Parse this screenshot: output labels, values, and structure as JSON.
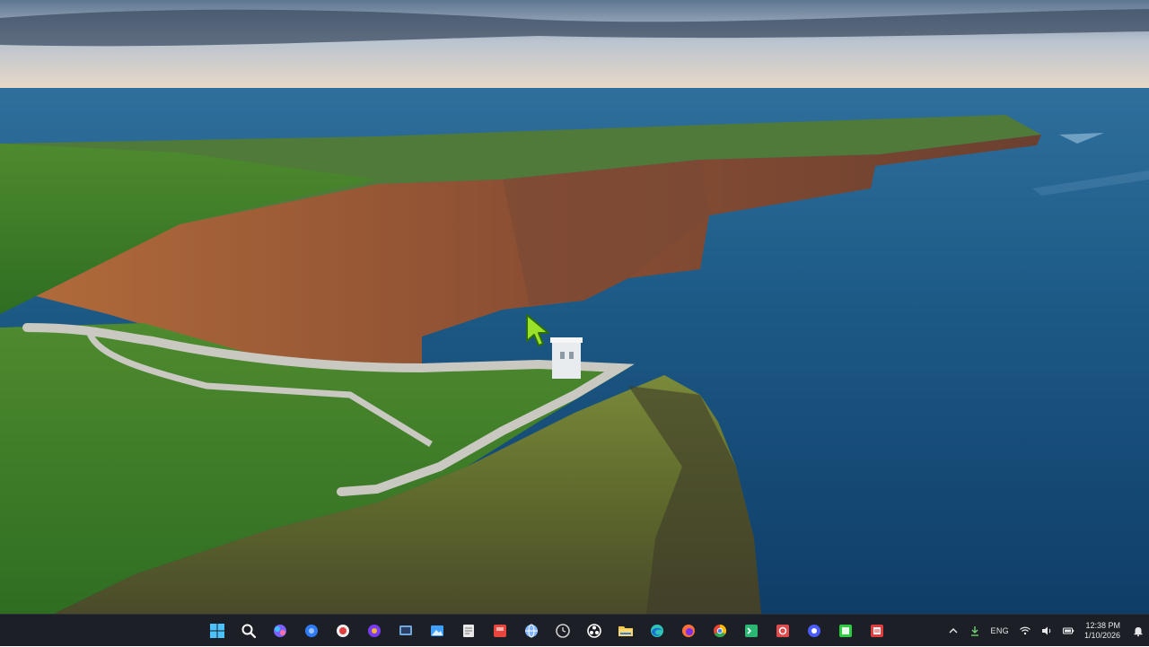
{
  "desktop": {
    "wallpaper": "Cliffs coastline with tower"
  },
  "taskbar": {
    "apps": [
      {
        "name": "start-button",
        "icon": "windows-logo-icon",
        "color": "#4cc2ff"
      },
      {
        "name": "search-button",
        "icon": "search-icon",
        "color": "#ffffff"
      },
      {
        "name": "copilot-button",
        "icon": "copilot-icon",
        "color": "#7b61ff"
      },
      {
        "name": "app-blue-circle",
        "icon": "blue-circle-app-icon",
        "color": "#2f7bf5"
      },
      {
        "name": "app-red-record",
        "icon": "record-app-icon",
        "color": "#e04040"
      },
      {
        "name": "app-purple-circle",
        "icon": "purple-app-icon",
        "color": "#7a3cf0"
      },
      {
        "name": "app-task-view",
        "icon": "task-view-icon",
        "color": "#6fa8dc"
      },
      {
        "name": "app-photos",
        "icon": "photos-icon",
        "color": "#3fa0ff"
      },
      {
        "name": "app-notepad",
        "icon": "notepad-icon",
        "color": "#e8e8e8"
      },
      {
        "name": "app-red-square",
        "icon": "red-square-app-icon",
        "color": "#e8453c"
      },
      {
        "name": "app-settings-globe",
        "icon": "globe-icon",
        "color": "#7fb3ff"
      },
      {
        "name": "app-clock",
        "icon": "clock-icon",
        "color": "#d0d0d0"
      },
      {
        "name": "app-obs",
        "icon": "obs-icon",
        "color": "#ffffff"
      },
      {
        "name": "app-file-explorer",
        "icon": "folder-icon",
        "color": "#f5c84c"
      },
      {
        "name": "app-edge",
        "icon": "edge-icon",
        "color": "#2ec4b6"
      },
      {
        "name": "app-firefox",
        "icon": "firefox-icon",
        "color": "#ff7139"
      },
      {
        "name": "app-chrome",
        "icon": "chrome-icon",
        "color": "#34a853"
      },
      {
        "name": "app-terminal",
        "icon": "terminal-icon",
        "color": "#2bb673"
      },
      {
        "name": "app-red-media",
        "icon": "media-app-icon",
        "color": "#e24b4b"
      },
      {
        "name": "app-blue-dot",
        "icon": "dot-app-icon",
        "color": "#4b5cff"
      },
      {
        "name": "app-green-square",
        "icon": "green-square-app-icon",
        "color": "#2ecc40"
      },
      {
        "name": "app-red-doc",
        "icon": "document-app-icon",
        "color": "#e23c3c"
      }
    ]
  },
  "tray": {
    "language": "ENG",
    "time": "12:38 PM",
    "date": "1/10/2026"
  }
}
